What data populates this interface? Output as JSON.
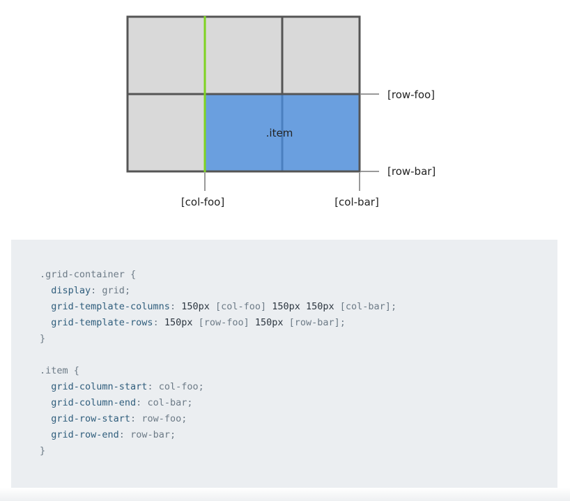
{
  "diagram": {
    "item_label": ".item",
    "row_labels": [
      "[row-foo]",
      "[row-bar]"
    ],
    "col_labels": [
      "[col-foo]",
      "[col-bar]"
    ],
    "colors": {
      "cell_fill": "#d9d9d9",
      "item_fill": "#6a9fdf",
      "grid_line": "#555555",
      "highlight_line": "#7ed321",
      "tick_line": "#999999"
    }
  },
  "code": {
    "lines": [
      [
        {
          "t": "sel",
          "v": ".grid-container {"
        }
      ],
      [
        {
          "t": "prop",
          "v": "  display"
        },
        {
          "t": "punc",
          "v": ": "
        },
        {
          "t": "val",
          "v": "grid"
        },
        {
          "t": "punc",
          "v": ";"
        }
      ],
      [
        {
          "t": "prop",
          "v": "  grid-template-columns"
        },
        {
          "t": "punc",
          "v": ": "
        },
        {
          "t": "num",
          "v": "150px"
        },
        {
          "t": "val",
          "v": " [col-foo] "
        },
        {
          "t": "num",
          "v": "150px 150px"
        },
        {
          "t": "val",
          "v": " [col-bar]"
        },
        {
          "t": "punc",
          "v": ";"
        }
      ],
      [
        {
          "t": "prop",
          "v": "  grid-template-rows"
        },
        {
          "t": "punc",
          "v": ": "
        },
        {
          "t": "num",
          "v": "150px"
        },
        {
          "t": "val",
          "v": " [row-foo] "
        },
        {
          "t": "num",
          "v": "150px"
        },
        {
          "t": "val",
          "v": " [row-bar]"
        },
        {
          "t": "punc",
          "v": ";"
        }
      ],
      [
        {
          "t": "sel",
          "v": "}"
        }
      ],
      [],
      [
        {
          "t": "sel",
          "v": ".item {"
        }
      ],
      [
        {
          "t": "prop",
          "v": "  grid-column-start"
        },
        {
          "t": "punc",
          "v": ": "
        },
        {
          "t": "val",
          "v": "col-foo"
        },
        {
          "t": "punc",
          "v": ";"
        }
      ],
      [
        {
          "t": "prop",
          "v": "  grid-column-end"
        },
        {
          "t": "punc",
          "v": ": "
        },
        {
          "t": "val",
          "v": "col-bar"
        },
        {
          "t": "punc",
          "v": ";"
        }
      ],
      [
        {
          "t": "prop",
          "v": "  grid-row-start"
        },
        {
          "t": "punc",
          "v": ": "
        },
        {
          "t": "val",
          "v": "row-foo"
        },
        {
          "t": "punc",
          "v": ";"
        }
      ],
      [
        {
          "t": "prop",
          "v": "  grid-row-end"
        },
        {
          "t": "punc",
          "v": ": "
        },
        {
          "t": "val",
          "v": "row-bar"
        },
        {
          "t": "punc",
          "v": ";"
        }
      ],
      [
        {
          "t": "sel",
          "v": "}"
        }
      ]
    ]
  }
}
